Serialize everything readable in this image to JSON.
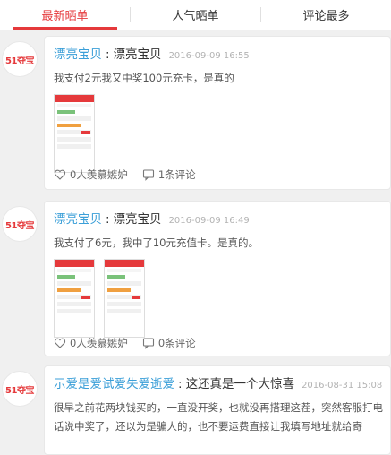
{
  "tabs": [
    {
      "label": "最新晒单",
      "active": true
    },
    {
      "label": "人气晒单",
      "active": false
    },
    {
      "label": "评论最多",
      "active": false
    }
  ],
  "avatar_logo": "51夺宝",
  "posts": [
    {
      "user": "漂亮宝贝",
      "title": "漂亮宝贝",
      "time": "2016-09-09 16:55",
      "content": "我支付2元我又中奖100元充卡，是真的",
      "images": 1,
      "likes": "0人羡慕嫉妒",
      "comments": "1条评论"
    },
    {
      "user": "漂亮宝贝",
      "title": "漂亮宝贝",
      "time": "2016-09-09 16:49",
      "content": "我支付了6元，我中了10元充值卡。是真的。",
      "images": 2,
      "likes": "0人羡慕嫉妒",
      "comments": "0条评论"
    },
    {
      "user": "示爱是爱试爱失爱逝爱",
      "title": "这还真是一个大惊喜",
      "time": "2016-08-31 15:08",
      "content": "很早之前花两块钱买的，一直没开奖，也就没再搭理这茬，突然客服打电话说中奖了，还以为是骗人的，也不要运费直接让我填写地址就给寄"
    }
  ],
  "colors": {
    "accent": "#e5393b",
    "username": "#3b9fd8"
  },
  "icons": {
    "likes": "heart-outline-icon",
    "comments": "comment-bubble-icon"
  }
}
